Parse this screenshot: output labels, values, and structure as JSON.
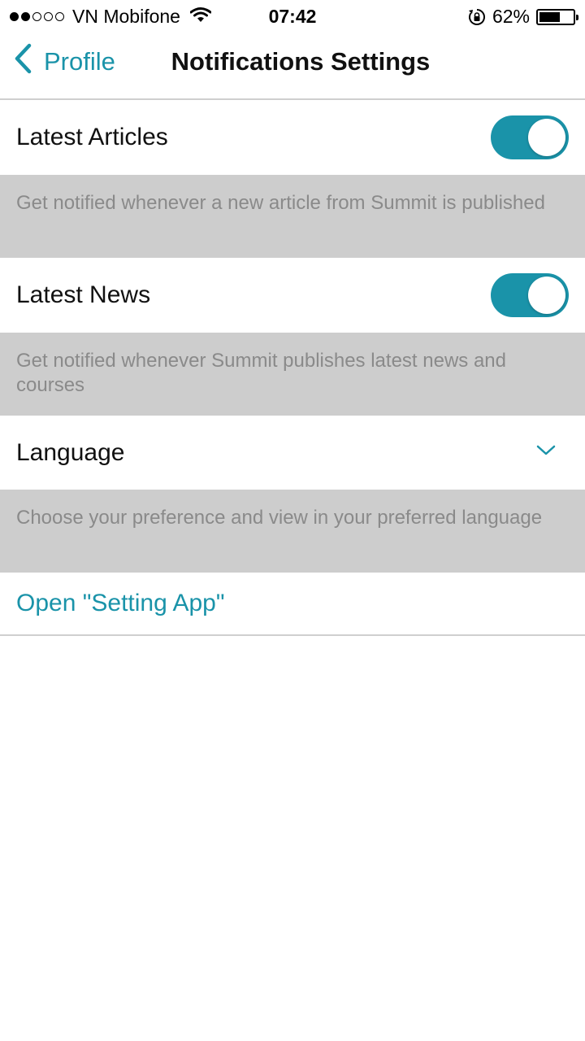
{
  "status_bar": {
    "carrier": "VN Mobifone",
    "time": "07:42",
    "battery_percent": "62%",
    "battery_level": 0.62,
    "signal_bars_filled": 2,
    "signal_bars_total": 5
  },
  "nav": {
    "back_label": "Profile",
    "title": "Notifications Settings"
  },
  "settings": {
    "latest_articles": {
      "label": "Latest Articles",
      "enabled": true,
      "description": "Get notified whenever a new article from Summit is published"
    },
    "latest_news": {
      "label": "Latest News",
      "enabled": true,
      "description": "Get notified whenever Summit publishes latest news and courses"
    },
    "language": {
      "label": "Language",
      "description": "Choose your preference and view in your preferred language"
    },
    "open_settings_label": "Open \"Setting App\""
  },
  "colors": {
    "accent": "#1a93a9",
    "description_bg": "#cdcdcd",
    "description_text": "#8a8a8a"
  },
  "icons": {
    "back": "chevron-left-icon",
    "language_dropdown": "chevron-down-icon",
    "wifi": "wifi-icon",
    "rotation_lock": "rotation-lock-icon",
    "battery": "battery-icon"
  }
}
